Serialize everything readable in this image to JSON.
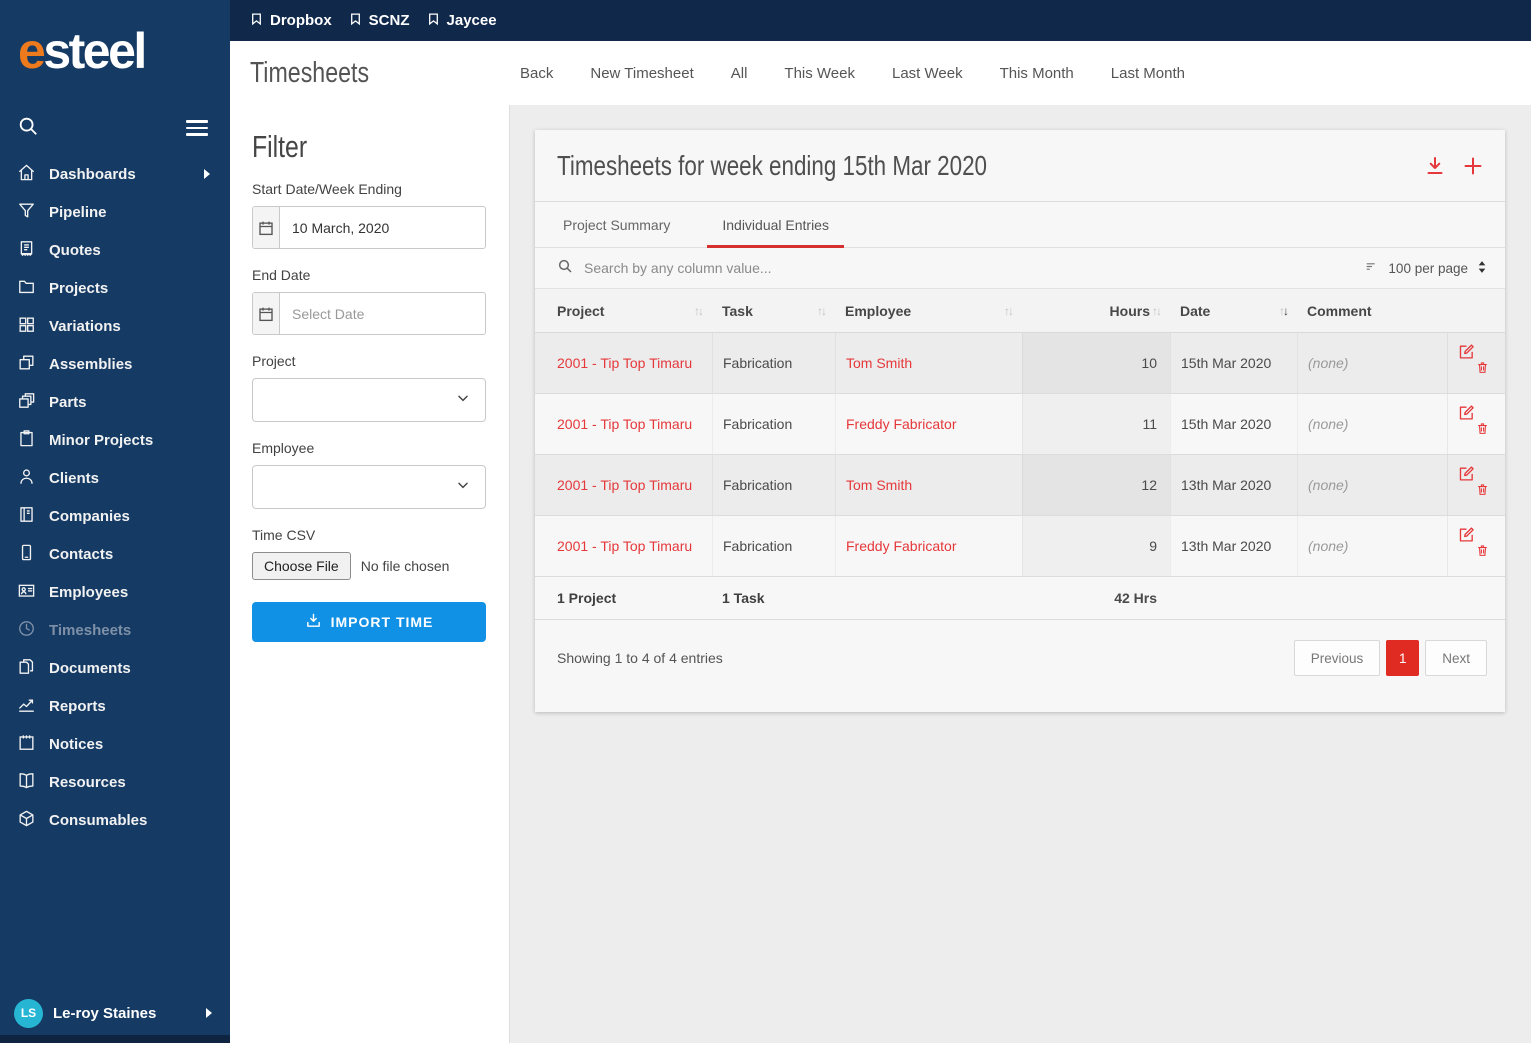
{
  "colors": {
    "navy": "#153a64",
    "navy_dark": "#10294b",
    "accent_red": "#e5383b",
    "accent_red_deep": "#e02b22",
    "accent_blue": "#1191e5",
    "logo_orange": "#ed7b1d",
    "avatar_cyan": "#27b5d4"
  },
  "topbar": {
    "bookmarks": [
      {
        "icon": "bookmark-icon",
        "label": "Dropbox"
      },
      {
        "icon": "bookmark-icon",
        "label": "SCNZ"
      },
      {
        "icon": "bookmark-icon",
        "label": "Jaycee"
      }
    ]
  },
  "brand": {
    "logo_prefix": "e",
    "logo_rest": "steel"
  },
  "header": {
    "title": "Timesheets",
    "nav": [
      {
        "label": "Back"
      },
      {
        "label": "New Timesheet"
      },
      {
        "label": "All"
      },
      {
        "label": "This Week"
      },
      {
        "label": "Last Week"
      },
      {
        "label": "This Month"
      },
      {
        "label": "Last Month"
      }
    ]
  },
  "sidebar": {
    "items": [
      {
        "label": "Dashboards",
        "icon": "home-icon",
        "has_submenu": true,
        "active": false
      },
      {
        "label": "Pipeline",
        "icon": "funnel-icon",
        "active": false
      },
      {
        "label": "Quotes",
        "icon": "receipt-icon",
        "active": false
      },
      {
        "label": "Projects",
        "icon": "folder-icon",
        "active": false
      },
      {
        "label": "Variations",
        "icon": "grid-icon",
        "active": false
      },
      {
        "label": "Assemblies",
        "icon": "copy-icon",
        "active": false
      },
      {
        "label": "Parts",
        "icon": "layers-icon",
        "active": false
      },
      {
        "label": "Minor Projects",
        "icon": "clipboard-icon",
        "active": false
      },
      {
        "label": "Clients",
        "icon": "person-icon",
        "active": false
      },
      {
        "label": "Companies",
        "icon": "ledger-icon",
        "active": false
      },
      {
        "label": "Contacts",
        "icon": "phone-icon",
        "active": false
      },
      {
        "label": "Employees",
        "icon": "id-card-icon",
        "active": false
      },
      {
        "label": "Timesheets",
        "icon": "clock-icon",
        "active": true
      },
      {
        "label": "Documents",
        "icon": "pages-icon",
        "active": false
      },
      {
        "label": "Reports",
        "icon": "trend-icon",
        "active": false
      },
      {
        "label": "Notices",
        "icon": "calendar-icon",
        "active": false
      },
      {
        "label": "Resources",
        "icon": "open-book-icon",
        "active": false
      },
      {
        "label": "Consumables",
        "icon": "box-icon",
        "active": false
      }
    ],
    "user": {
      "initials": "LS",
      "name": "Le-roy Staines"
    }
  },
  "filter": {
    "title": "Filter",
    "start_date": {
      "label": "Start Date/Week Ending",
      "value": "10 March, 2020",
      "icon": "calendar-icon"
    },
    "end_date": {
      "label": "End Date",
      "placeholder": "Select Date",
      "icon": "calendar-icon"
    },
    "project": {
      "label": "Project",
      "value": ""
    },
    "employee": {
      "label": "Employee",
      "value": ""
    },
    "time_csv": {
      "label": "Time CSV",
      "button": "Choose File",
      "status": "No file chosen"
    },
    "import_button": {
      "label": "IMPORT TIME",
      "icon": "download-tray-icon"
    }
  },
  "main": {
    "card_title": "Timesheets for week ending 15th Mar 2020",
    "header_icons": [
      "download-icon",
      "plus-icon"
    ],
    "tabs": [
      {
        "label": "Project Summary",
        "active": false
      },
      {
        "label": "Individual Entries",
        "active": true
      }
    ],
    "search": {
      "placeholder": "Search by any column value...",
      "icon": "search-icon"
    },
    "page_size": "100 per page",
    "table": {
      "columns": [
        {
          "label": "Project",
          "sortable": true
        },
        {
          "label": "Task",
          "sortable": true
        },
        {
          "label": "Employee",
          "sortable": true
        },
        {
          "label": "Hours",
          "sortable": true
        },
        {
          "label": "Date",
          "sortable": true,
          "sorted": "desc"
        },
        {
          "label": "Comment",
          "sortable": false
        }
      ],
      "rows": [
        {
          "project": "2001 - Tip Top Timaru",
          "task": "Fabrication",
          "employee": "Tom Smith",
          "hours": "10",
          "date": "15th Mar 2020",
          "comment": "(none)"
        },
        {
          "project": "2001 - Tip Top Timaru",
          "task": "Fabrication",
          "employee": "Freddy Fabricator",
          "hours": "11",
          "date": "15th Mar 2020",
          "comment": "(none)"
        },
        {
          "project": "2001 - Tip Top Timaru",
          "task": "Fabrication",
          "employee": "Tom Smith",
          "hours": "12",
          "date": "13th Mar 2020",
          "comment": "(none)"
        },
        {
          "project": "2001 - Tip Top Timaru",
          "task": "Fabrication",
          "employee": "Freddy Fabricator",
          "hours": "9",
          "date": "13th Mar 2020",
          "comment": "(none)"
        }
      ],
      "totals": {
        "project": "1 Project",
        "task": "1 Task",
        "hours": "42 Hrs"
      },
      "info": "Showing 1 to 4 of 4 entries",
      "pagination": {
        "previous": "Previous",
        "current": "1",
        "next": "Next"
      }
    }
  }
}
